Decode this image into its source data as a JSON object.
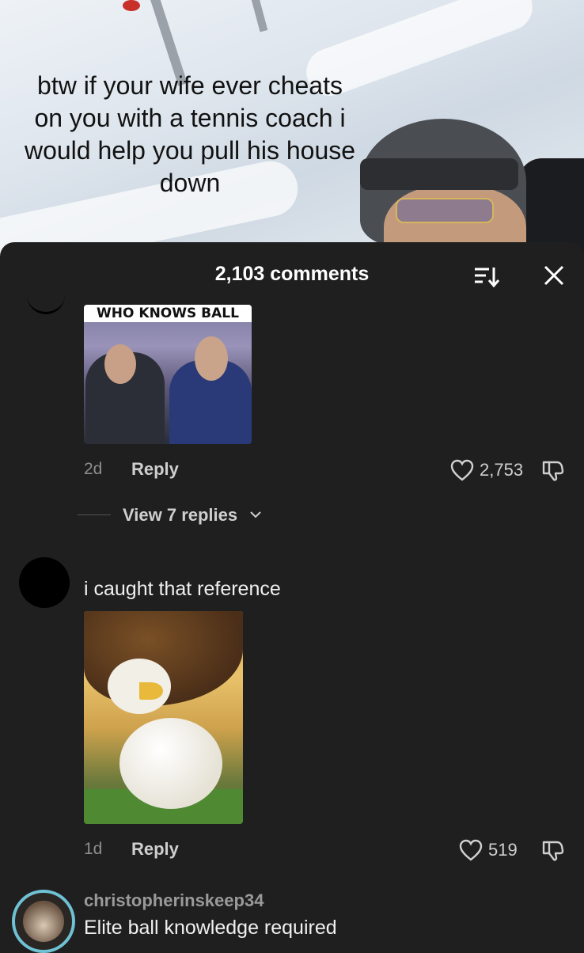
{
  "video": {
    "caption": "btw if your wife ever cheats on you with a tennis coach i would help you pull his house down"
  },
  "header": {
    "comment_count": "2,103 comments"
  },
  "comments": [
    {
      "image_banner": "WHO KNOWS BALL",
      "age": "2d",
      "reply_label": "Reply",
      "likes": "2,753",
      "view_replies": "View 7 replies"
    },
    {
      "text": "i caught that reference",
      "age": "1d",
      "reply_label": "Reply",
      "likes": "519"
    },
    {
      "username": "christopherinskeep34",
      "text": "Elite ball knowledge required"
    }
  ],
  "colors": {
    "sheet_bg": "#1f1f1f",
    "avatar_ring": "#6ec2d4"
  }
}
